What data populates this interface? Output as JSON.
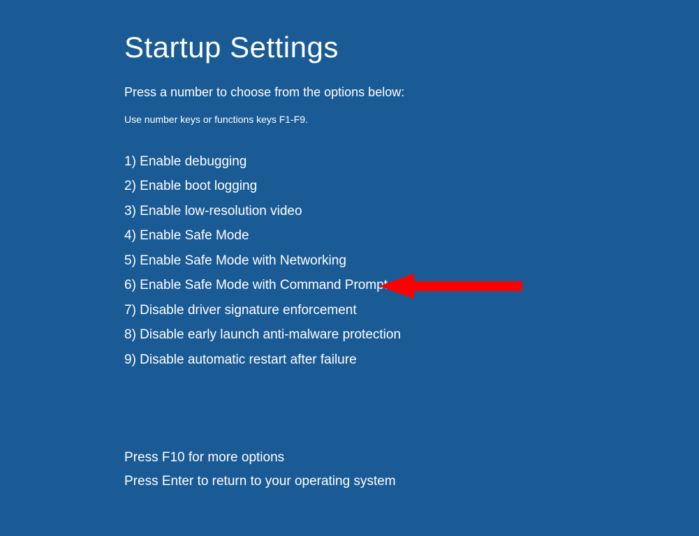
{
  "title": "Startup Settings",
  "subtitle": "Press a number to choose from the options below:",
  "hint": "Use number keys or functions keys F1-F9.",
  "options": [
    "1) Enable debugging",
    "2) Enable boot logging",
    "3) Enable low-resolution video",
    "4) Enable Safe Mode",
    "5) Enable Safe Mode with Networking",
    "6) Enable Safe Mode with Command Prompt",
    "7) Disable driver signature enforcement",
    "8) Disable early launch anti-malware protection",
    "9) Disable automatic restart after failure"
  ],
  "footer": {
    "more_options": "Press F10 for more options",
    "return": "Press Enter to return to your operating system"
  },
  "annotation": {
    "arrow_color": "#ff0000"
  }
}
